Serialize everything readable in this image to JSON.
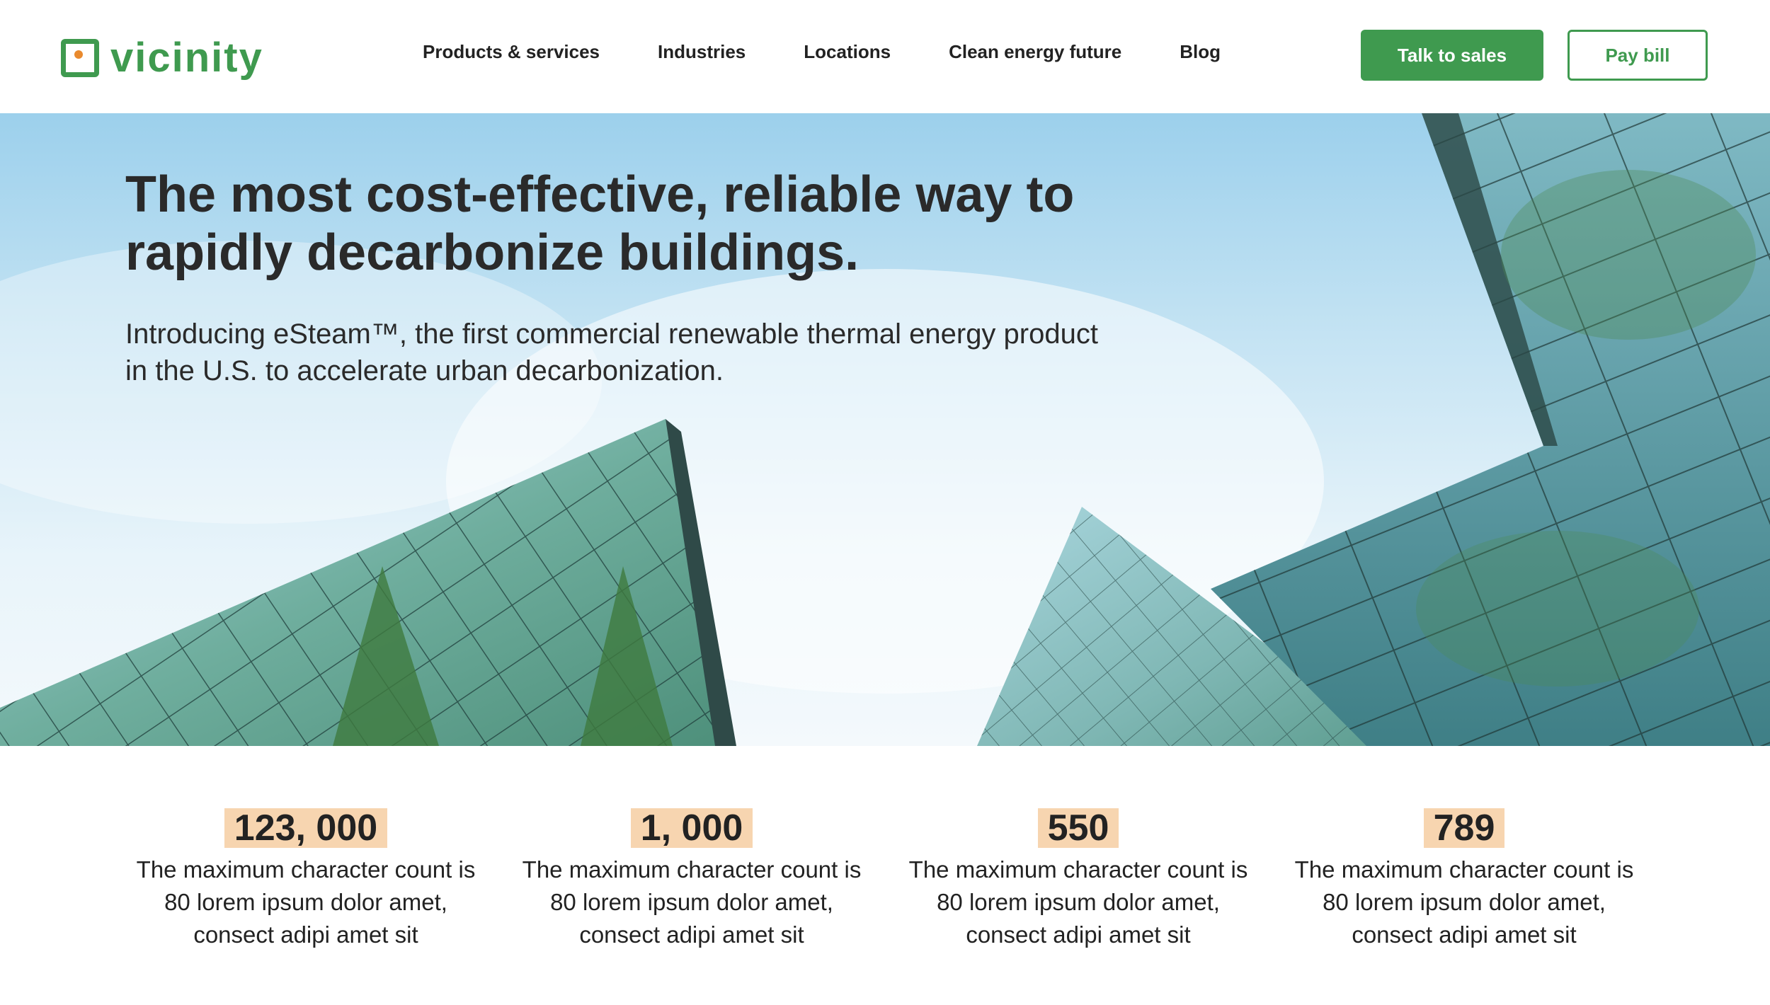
{
  "header": {
    "logo_text": "vicinity",
    "nav": [
      {
        "label": "Products & services"
      },
      {
        "label": "Industries"
      },
      {
        "label": "Locations"
      },
      {
        "label": "Clean energy future"
      },
      {
        "label": "Blog"
      }
    ],
    "cta_sales": "Talk to sales",
    "cta_pay": "Pay bill"
  },
  "hero": {
    "title": "The most cost-effective, reliable way to rapidly decarbonize buildings.",
    "subtitle": "Introducing eSteam™, the first commercial renewable thermal energy product in the U.S. to accelerate urban decarbonization."
  },
  "stats": [
    {
      "value": "123, 000",
      "description": "The maximum character count is 80 lorem ipsum dolor amet, consect adipi amet sit"
    },
    {
      "value": "1, 000",
      "description": "The maximum character count is 80 lorem ipsum dolor amet, consect adipi amet sit"
    },
    {
      "value": "550",
      "description": "The maximum character count is 80 lorem ipsum dolor amet, consect adipi amet sit"
    },
    {
      "value": "789",
      "description": "The maximum character count is 80 lorem ipsum dolor amet, consect adipi amet sit"
    }
  ],
  "colors": {
    "brand_green": "#3f9a4f",
    "logo_dot": "#e98a2e",
    "stat_highlight": "#f7d5b0"
  }
}
